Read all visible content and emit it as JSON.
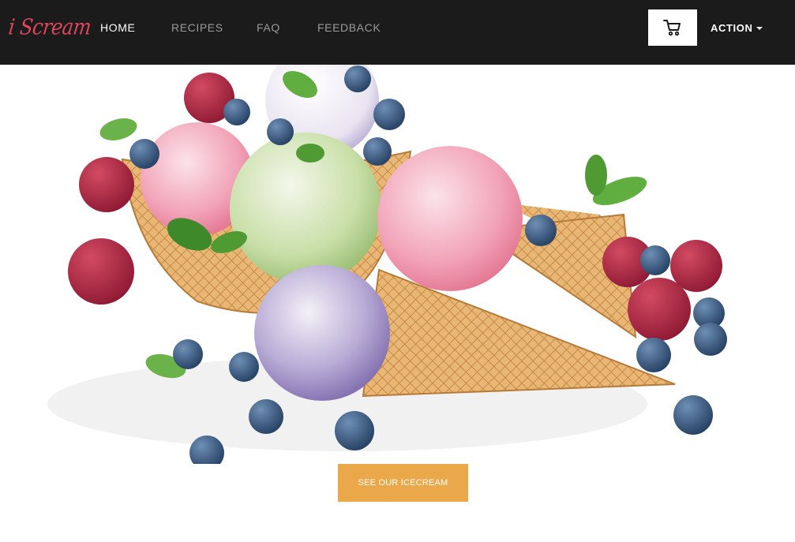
{
  "brand": {
    "name": "i Scream",
    "color": "#e0455f"
  },
  "nav": {
    "items": [
      {
        "label": "HOME",
        "active": true
      },
      {
        "label": "RECIPES",
        "active": false
      },
      {
        "label": "FAQ",
        "active": false
      },
      {
        "label": "FEEDBACK",
        "active": false
      }
    ],
    "cart_icon": "shopping-cart-icon",
    "action_label": "ACTION",
    "action_icon": "caret-down-icon"
  },
  "hero": {
    "image": "ice-cream-cones-with-berries",
    "cta_label": "SEE OUR ICECREAM",
    "cta_color": "#eaa84a"
  },
  "colors": {
    "navbar_bg": "#1b1b1b",
    "nav_active": "#ffffff",
    "nav_inactive": "#9a9a9a"
  }
}
